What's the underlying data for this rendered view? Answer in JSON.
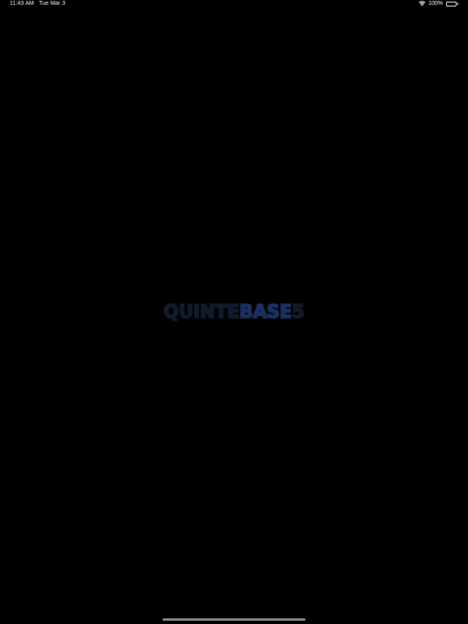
{
  "status_bar": {
    "time": "11:43 AM",
    "date": "Tue Mar 3",
    "battery": "100%",
    "icons": [
      "wifi-icon",
      "battery-icon"
    ]
  },
  "logo": {
    "part1": "QUINTE",
    "part2": "BASE",
    "part3": "5"
  },
  "colors": {
    "background": "#000000",
    "logo_outline": "#64748c",
    "logo_accent": "#1b3060",
    "home_indicator": "#8e8e93"
  }
}
